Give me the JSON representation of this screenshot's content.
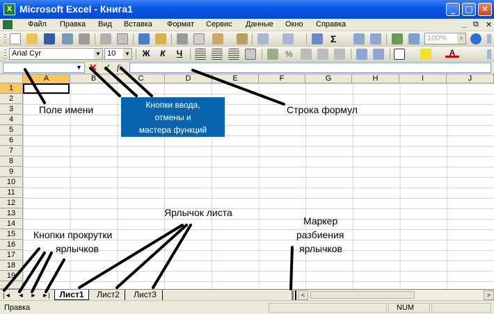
{
  "window": {
    "title": "Microsoft Excel - Книга1",
    "app_icon": "excel-icon"
  },
  "window_buttons": {
    "minimize": "_",
    "maximize": "□",
    "close": "✕"
  },
  "menu": [
    "Файл",
    "Правка",
    "Вид",
    "Вставка",
    "Формат",
    "Сервис",
    "Данные",
    "Окно",
    "Справка"
  ],
  "menu_right": {
    "minimize": "_",
    "restore": "⧉",
    "close": "✕"
  },
  "standard_toolbar": {
    "sigma": "Σ",
    "zoom": "100%",
    "help_icon": "help-icon"
  },
  "format_toolbar": {
    "font": "Arial Cyr",
    "size": "10",
    "bold": "Ж",
    "italic": "К",
    "underline": "Ч",
    "font_color_letter": "A"
  },
  "formula_bar": {
    "cancel": "✕",
    "enter": "✓",
    "fx": "fx",
    "name_box_value": "",
    "formula_value": ""
  },
  "columns": [
    "A",
    "B",
    "C",
    "D",
    "E",
    "F",
    "G",
    "H",
    "I",
    "J"
  ],
  "rows": [
    "1",
    "2",
    "3",
    "4",
    "5",
    "6",
    "7",
    "8",
    "9",
    "10",
    "11",
    "12",
    "13",
    "14",
    "15",
    "16",
    "17",
    "18",
    "19"
  ],
  "sheet_nav": {
    "first": "|◄",
    "prev": "◄",
    "next": "►",
    "last": "►|"
  },
  "sheets": [
    "Лист1",
    "Лист2",
    "Лист3"
  ],
  "scroll": {
    "left": "<",
    "right": ">"
  },
  "status": {
    "mode": "Правка",
    "indicator": "NUM"
  },
  "annotations": {
    "name_field": "Поле имени",
    "callout_lines": [
      "Кнопки ввода,",
      "отмены и",
      "мастера функций"
    ],
    "formula_bar": "Строка формул",
    "sheet_tab": "Ярлычок листа",
    "scroll_buttons": [
      "Кнопки прокрутки",
      "ярлычков"
    ],
    "split_marker": [
      "Маркер",
      "разбиения",
      "ярлычков"
    ]
  },
  "colors": {
    "titlebar": "#0a58e2",
    "callout": "#0a64ad",
    "selection": "#f9c65f"
  }
}
